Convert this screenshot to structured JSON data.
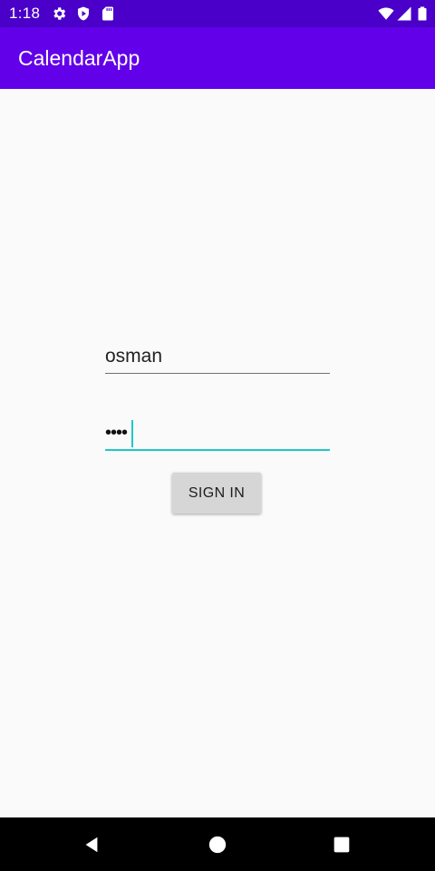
{
  "status_bar": {
    "time": "1:18",
    "icons": [
      "settings-gear-icon",
      "shield-play-icon",
      "sd-card-icon",
      "wifi-icon",
      "cell-signal-icon",
      "battery-icon"
    ]
  },
  "app_bar": {
    "title": "CalendarApp"
  },
  "login_form": {
    "username_value": "osman",
    "password_masked": "••••",
    "sign_in_label": "SIGN IN"
  },
  "nav_bar": {
    "buttons": [
      "back-icon",
      "home-icon",
      "recents-icon"
    ]
  },
  "colors": {
    "status_bar": "#4a00c9",
    "app_bar": "#6200ea",
    "focus_accent": "#1ec8c8",
    "background": "#fafafa",
    "button": "#d6d6d6"
  }
}
